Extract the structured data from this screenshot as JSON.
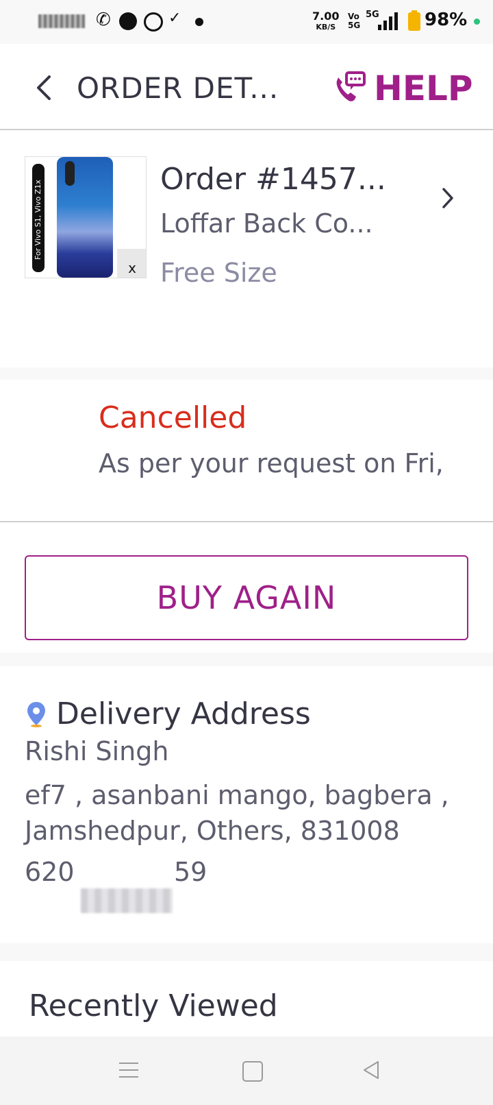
{
  "status_bar": {
    "speed": "7.00",
    "speed_unit": "KB/S",
    "volte": "Vo",
    "volte_sub": "5G",
    "network": "5G",
    "battery": "98%"
  },
  "header": {
    "back_icon": "chevron-left-icon",
    "title": "ORDER DET...",
    "help_icon": "phone-chat-icon",
    "help_label": "HELP"
  },
  "order": {
    "thumbnail_caption": "For Vivo S1, Vivo Z1x",
    "thumbnail_badge": "x",
    "order_number": "Order #1457...",
    "product_name": "Loffar Back Co...",
    "size": "Free Size",
    "chevron_icon": "chevron-right-icon"
  },
  "order_status": {
    "status": "Cancelled",
    "detail": "As per your request on Fri,",
    "status_color": "#d92d1c"
  },
  "actions": {
    "buy_again_label": "BUY AGAIN",
    "accent_color": "#9f2089"
  },
  "delivery": {
    "icon": "location-pin-icon",
    "title": "Delivery Address",
    "name": "Rishi Singh",
    "address_line1": "ef7 , asanbani mango, bagbera ,",
    "address_line2": "Jamshedpur, Others, 831008",
    "phone_prefix": "620",
    "phone_suffix": "59"
  },
  "recently_viewed": {
    "title": "Recently Viewed"
  },
  "nav_bar": {
    "menu_icon": "menu-icon",
    "home_icon": "home-square-icon",
    "back_icon": "back-triangle-icon"
  }
}
